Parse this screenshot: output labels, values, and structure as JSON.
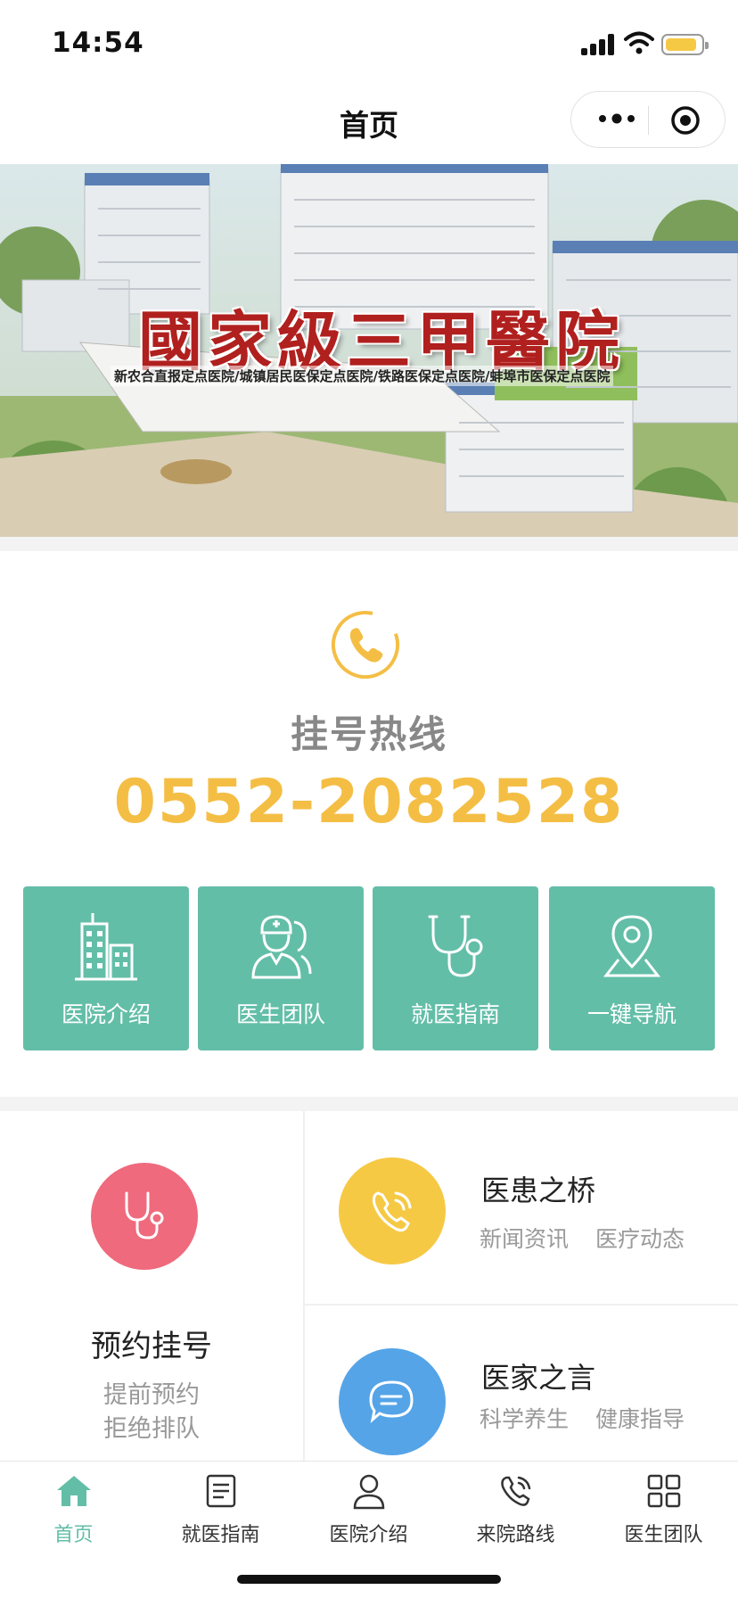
{
  "status_bar": {
    "time": "14:54"
  },
  "nav": {
    "title": "首页"
  },
  "banner": {
    "title": "國家級三甲醫院",
    "subtitle": "新农合直报定点医院/城镇居民医保定点医院/铁路医保定点医院/蚌埠市医保定点医院"
  },
  "hotline": {
    "label": "挂号热线",
    "number": "0552-2082528"
  },
  "tiles": [
    {
      "label": "医院介绍",
      "icon": "buildings-icon"
    },
    {
      "label": "医生团队",
      "icon": "doctor-icon"
    },
    {
      "label": "就医指南",
      "icon": "stethoscope-icon"
    },
    {
      "label": "一键导航",
      "icon": "location-pin-icon"
    }
  ],
  "appointment": {
    "title": "预约挂号",
    "line1": "提前预约",
    "line2": "拒绝排队"
  },
  "bridge": {
    "title": "医患之桥",
    "tag1": "新闻资讯",
    "tag2": "医疗动态"
  },
  "words": {
    "title": "医家之言",
    "tag1": "科学养生",
    "tag2": "健康指导"
  },
  "tabbar": [
    {
      "label": "首页",
      "icon": "home-icon",
      "active": true
    },
    {
      "label": "就医指南",
      "icon": "document-icon"
    },
    {
      "label": "医院介绍",
      "icon": "person-icon"
    },
    {
      "label": "来院路线",
      "icon": "phone-route-icon"
    },
    {
      "label": "医生团队",
      "icon": "grid-icon"
    }
  ],
  "colors": {
    "accent": "#63bea8",
    "hotline": "#f4be45",
    "appointment": "#ef6a7d",
    "bridge": "#f6c945",
    "words": "#55a4e8"
  }
}
